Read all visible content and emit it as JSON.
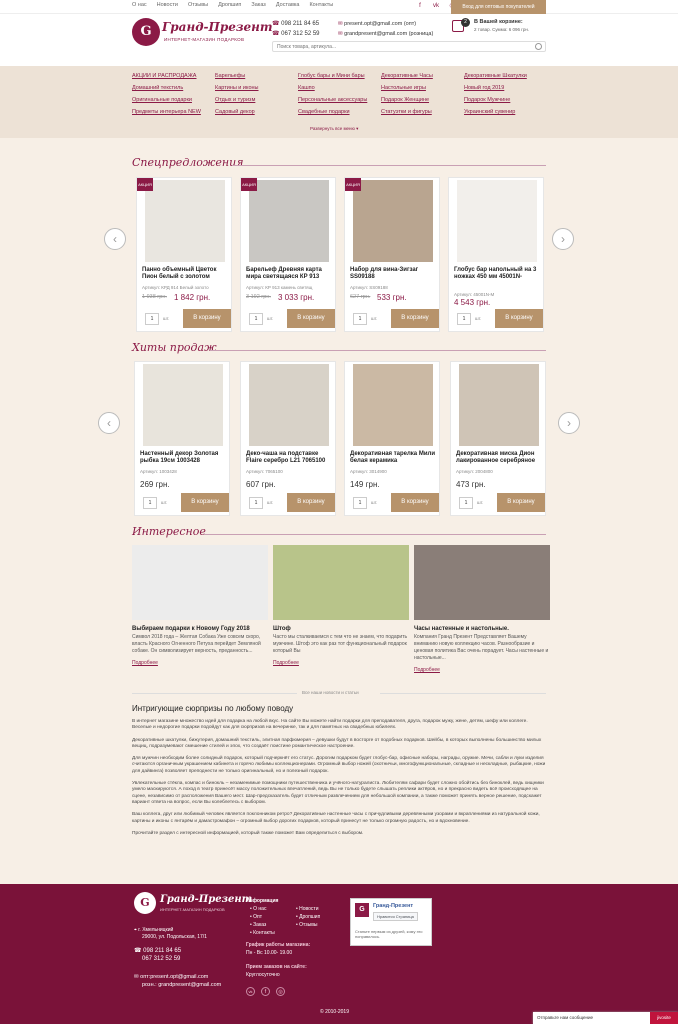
{
  "topbar": {
    "links": [
      "О нас",
      "Новости",
      "Отзывы",
      "Дропшип",
      "Заказ",
      "Доставка",
      "Контакты"
    ],
    "social_icons": [
      "facebook-icon",
      "vk-icon",
      "instagram-icon"
    ],
    "wholesale_button": "Вход для оптовых покупателей"
  },
  "header": {
    "logo_letter": "G",
    "brand": "Гранд-Презент",
    "brand_sub": "ИНТЕРНЕТ-МАГАЗИН ПОДАРКОВ",
    "phone1": "098 211 84 65",
    "phone2": "067 312 52 59",
    "email1": "present.opt@gmail.com (опт)",
    "email2": "grandpresent@gmail.com (розница)",
    "cart_count": "2",
    "cart_title": "В Вашей корзине:",
    "cart_sub": "2 товар. Сумма: 6 096 грн.",
    "search_placeholder": "Поиск товара, артикула..."
  },
  "menu": {
    "items": [
      "АКЦИИ И РАСПРОДАЖА",
      "Барельефы",
      "Глобус бары и Мини бары",
      "Декоративные Часы",
      "Декоративные Шкатулки",
      "Домашний текстиль",
      "Картины и иконы",
      "Кашпо",
      "Настольные игры",
      "Новый год 2019",
      "Оригинальные подарки",
      "Отдых и туризм",
      "Персональные аксессуары",
      "Подарок Женщине",
      "Подарок Мужчине",
      "Предметы интерьера NEW",
      "Садовый декор",
      "Свадебные подарки",
      "Статуэтки и фигуры",
      "Украинский сувенир"
    ],
    "more": "Развернуть все меню"
  },
  "specials": {
    "title": "Спецпредложения",
    "ribbon": "АКЦИЯ",
    "qty": "1",
    "unit": "шт.",
    "buy": "В корзину",
    "items": [
      {
        "name": "Панно объемный Цветок Пион белый с золотом",
        "art": "Артикул: КРД 914 Белый золото",
        "old": "1 938 грн.",
        "price": "1 842 грн."
      },
      {
        "name": "Барельеф Древняя карта мира светящаяся КР 913",
        "art": "Артикул: КР 913 камень светящ",
        "old": "3 192 грн.",
        "price": "3 033 грн."
      },
      {
        "name": "Набор для вина-Зигзаг SS09188",
        "art": "Артикул: SS09188",
        "old": "627 грн.",
        "price": "533 грн."
      },
      {
        "name": "Глобус бар напольный на 3 ножках 450 мм 45001N-",
        "art": "Артикул: 45001N-M",
        "old": "",
        "price": "4 543 грн."
      }
    ]
  },
  "hits": {
    "title": "Хиты продаж",
    "qty": "1",
    "unit": "шт.",
    "buy": "В корзину",
    "items": [
      {
        "name": "Настенный декор Золотая рыбка 19см 1003428",
        "art": "Артикул: 1003428",
        "price": "269 грн."
      },
      {
        "name": "Деко-чаша на подставке Flaire серебро L21 7065100",
        "art": "Артикул: 7065100",
        "price": "607 грн."
      },
      {
        "name": "Декоративная тарелка Мили белая керамика",
        "art": "Артикул: 3014900",
        "price": "149 грн."
      },
      {
        "name": "Декоративная миска Дион лакированное серебряное",
        "art": "Артикул: 2004800",
        "price": "473 грн."
      }
    ]
  },
  "interesting": {
    "title": "Интересное",
    "more_label": "Подробнее",
    "all_news": "Все наши новости и статьи",
    "items": [
      {
        "title": "Выбираем подарки к Новому Году 2018",
        "text": "Символ 2018 года – Желтая Собака Уже совсем скоро, власть Красного Огненного Петуха перейдет Земляной собаке. Он символизирует верность, преданность..."
      },
      {
        "title": "Штоф",
        "text": "Часто мы сталкиваемся с тем что не знаем, что подарить мужчине. Штоф это как раз тот функциональный подарок который Вы"
      },
      {
        "title": "Часы настенные и настольные.",
        "text": "Компания Гранд Презент Представляет Вашему вниманию новую коллекцию часов. Разнообразие и ценовая политика Вас очень порадует. Часы настенные и настольные..."
      }
    ]
  },
  "article": {
    "title": "Интригующие сюрпризы по любому поводу",
    "paragraphs": [
      "В интернет магазине множество идей для подарка на любой вкус. На сайте Вы можете найти подарки для преподавателя, друга, подарок мужу, жене, детям, шефу или коллеге. Веселые и недорогие подарки подойдут как для сюрпризов на вечеринке, так и для памятных на свадебных юбилеях.",
      "Декоративные шкатулки, бижутерия, домашний текстиль, элитная парфюмерия – девушки будут в восторге от подобных подарков. Шейбы, в которых выполнены большинство милых вещиц, подразумевают смешение стилей и эпох, что создаёт поистине романтическое настроение.",
      "Для мужчин необходим более солидный подарок, который подчеркнёт его статус. Дорогим подарком будет глобус-бар, офисные наборы, награды, оружие. Мечи, сабли и луки изделия считаются органичным украшением кабинета и горячо любимы коллекционерами. Огромный выбор ножей (охотничьи, многофункциональные, складные и нескладные, рыбацкие, ножи для дайвинга) позволяет преподнести не только оригинальный, но и полезный подарок.",
      "Увлекательные стёкла, компас и бинокль – незаменимые помощники путешественника и учёного-натуралиста. Любителям сафари будет сложно обойтись без биноклей, ведь хищники умело маскируются. А поход в театр принесёт массу положительных впечатлений, ведь Вы не только будете слышать реплики актёров, но и прекрасно видеть всё происходящее на сцене, независимо от расположения Вашего мест. Шар-предсказатель будет отличным развлечением для небольшой компании, а также поможет принять верное решение, подскажет вариант ответа на вопрос, если Вы колеблетесь с выбором.",
      "Ваш коллега, друг или любимый человек является поклонником ретро? Декоративные настенные часы с причудливыми деревянными узорами и вкраплениями из натуральной кожи, картины и иконы с янтарём и дамастромафон – огромный выбор дорогих подарков, который принесут не только огромную радость, но и вдохновение.",
      "Прочитайте раздел с интересной информацией, который также поможет Вам определиться с выбором."
    ]
  },
  "footer": {
    "address_city": "г. Хмельницкий",
    "address_street": "29000, ул. Подольская, 17/1",
    "phone1": "098 211 84 65",
    "phone2": "067 312 52 59",
    "email_opt": "опт:present.opt@gmail.com",
    "email_retail": "розн.: grandpresent@gmail.com",
    "info_title": "Информация",
    "info_links": [
      "О нас",
      "Новости",
      "Опт",
      "Дропшип",
      "Заказ",
      "Отзывы",
      "Контакты"
    ],
    "schedule_title": "График работы магазина:",
    "schedule": "Пн - Вс 10.00- 19.00",
    "orders_title": "Прием заказов на сайте:",
    "orders": "Круглосуточно",
    "fb_name": "Гранд-Презент",
    "fb_like": "Нравится Страница",
    "fb_text": "Станьте первым из друзей, кому это понравилось.",
    "copyright": "© 2010-2019",
    "chat_label": "Отправьте нам сообщение",
    "chat_brand": "jivosite"
  }
}
